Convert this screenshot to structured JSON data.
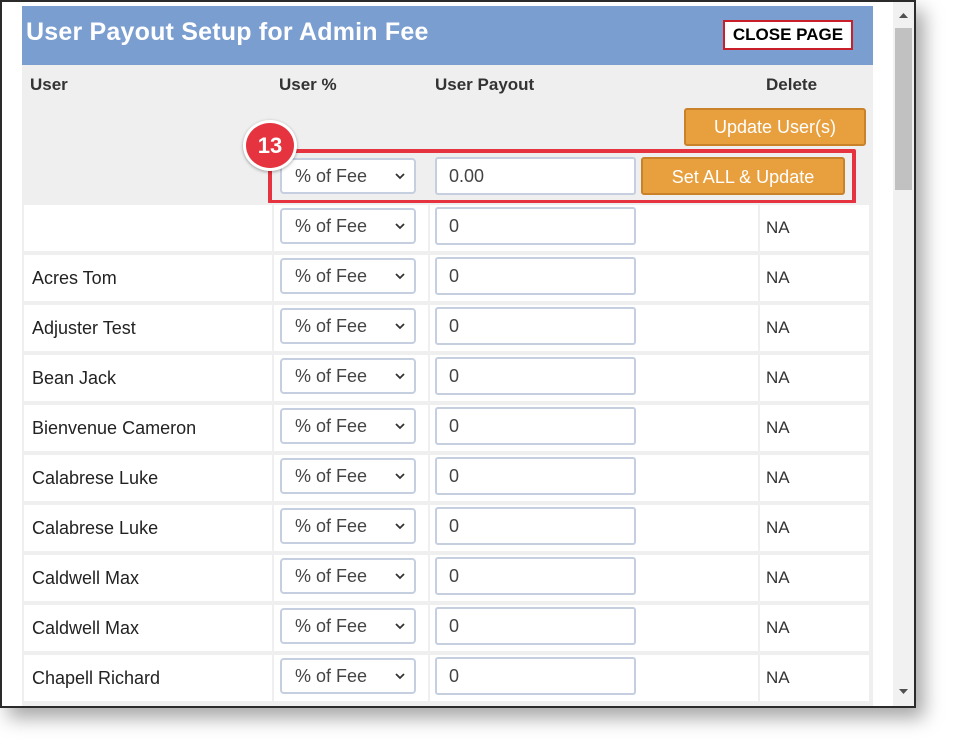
{
  "header": {
    "title": "User Payout Setup for Admin Fee",
    "close_label": "CLOSE PAGE"
  },
  "columns": {
    "user": "User",
    "user_pct": "User %",
    "user_payout": "User Payout",
    "delete": "Delete"
  },
  "update_users_label": "Update User(s)",
  "set_all": {
    "select_value": "% of Fee",
    "payout_value": "0.00",
    "button_label": "Set ALL & Update"
  },
  "callout_number": "13",
  "rows": [
    {
      "user": "",
      "pct": "% of Fee",
      "payout": "0",
      "delete": "NA"
    },
    {
      "user": "Acres Tom",
      "pct": "% of Fee",
      "payout": "0",
      "delete": "NA"
    },
    {
      "user": "Adjuster Test",
      "pct": "% of Fee",
      "payout": "0",
      "delete": "NA"
    },
    {
      "user": "Bean Jack",
      "pct": "% of Fee",
      "payout": "0",
      "delete": "NA"
    },
    {
      "user": "Bienvenue Cameron",
      "pct": "% of Fee",
      "payout": "0",
      "delete": "NA"
    },
    {
      "user": "Calabrese Luke",
      "pct": "% of Fee",
      "payout": "0",
      "delete": "NA"
    },
    {
      "user": "Calabrese Luke",
      "pct": "% of Fee",
      "payout": "0",
      "delete": "NA"
    },
    {
      "user": "Caldwell Max",
      "pct": "% of Fee",
      "payout": "0",
      "delete": "NA"
    },
    {
      "user": "Caldwell Max",
      "pct": "% of Fee",
      "payout": "0",
      "delete": "NA"
    },
    {
      "user": "Chapell Richard",
      "pct": "% of Fee",
      "payout": "0",
      "delete": "NA"
    }
  ],
  "colors": {
    "title_bar": "#7b9ed1",
    "orange_button": "#e8a03f",
    "highlight": "#e5343f"
  },
  "icons": {
    "dropdown": "chevron-down-icon"
  }
}
